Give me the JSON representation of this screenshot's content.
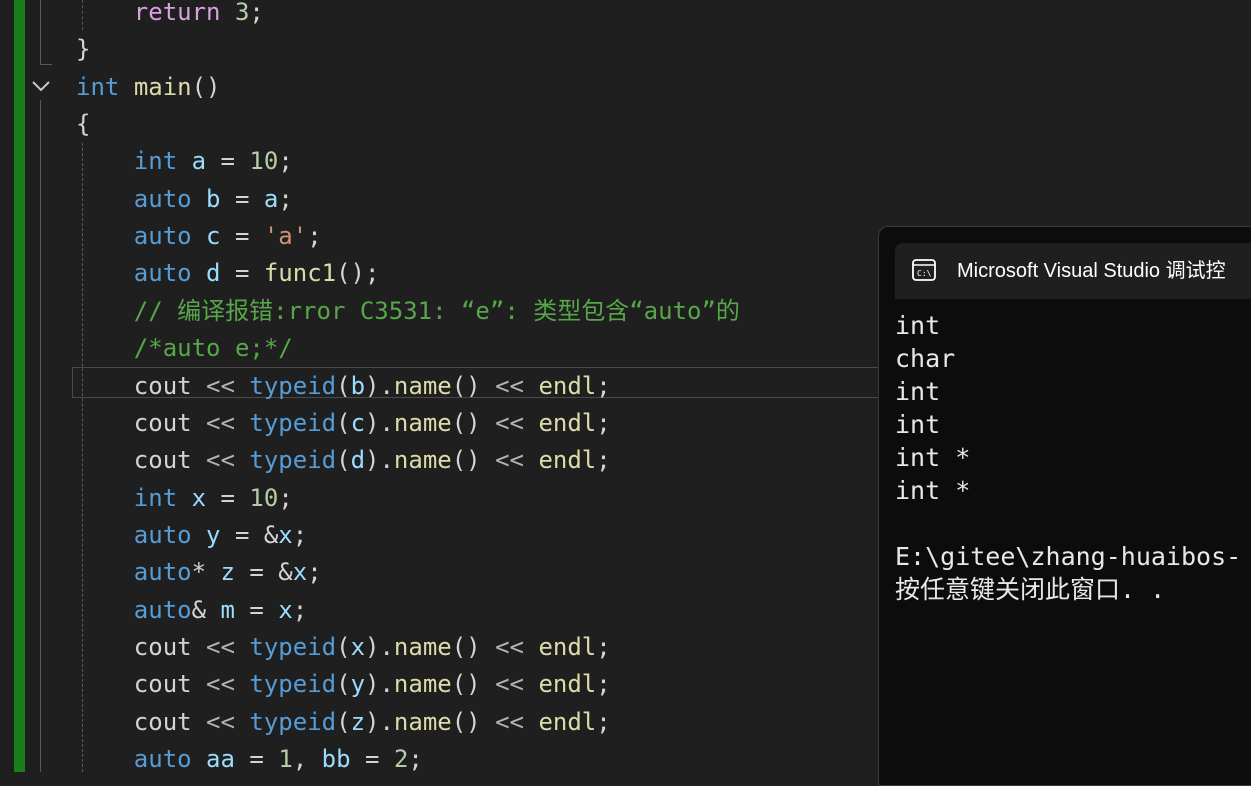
{
  "editor": {
    "lines": [
      {
        "indent": "        ",
        "tokens": [
          [
            "ctl",
            "return"
          ],
          [
            "pl",
            " "
          ],
          [
            "num",
            "3"
          ],
          [
            "pl",
            ";"
          ]
        ]
      },
      {
        "indent": "    ",
        "tokens": [
          [
            "pl",
            "}"
          ]
        ]
      },
      {
        "indent": "    ",
        "tokens": [
          [
            "kw",
            "int"
          ],
          [
            "pl",
            " "
          ],
          [
            "fn",
            "main"
          ],
          [
            "pl",
            "()"
          ]
        ]
      },
      {
        "indent": "    ",
        "tokens": [
          [
            "pl",
            "{"
          ]
        ]
      },
      {
        "indent": "        ",
        "tokens": [
          [
            "kw",
            "int"
          ],
          [
            "pl",
            " "
          ],
          [
            "var",
            "a"
          ],
          [
            "pl",
            " = "
          ],
          [
            "num",
            "10"
          ],
          [
            "pl",
            ";"
          ]
        ]
      },
      {
        "indent": "        ",
        "tokens": [
          [
            "kw",
            "auto"
          ],
          [
            "pl",
            " "
          ],
          [
            "var",
            "b"
          ],
          [
            "pl",
            " = "
          ],
          [
            "var",
            "a"
          ],
          [
            "pl",
            ";"
          ]
        ]
      },
      {
        "indent": "        ",
        "tokens": [
          [
            "kw",
            "auto"
          ],
          [
            "pl",
            " "
          ],
          [
            "var",
            "c"
          ],
          [
            "pl",
            " = "
          ],
          [
            "str",
            "'a'"
          ],
          [
            "pl",
            ";"
          ]
        ]
      },
      {
        "indent": "        ",
        "tokens": [
          [
            "kw",
            "auto"
          ],
          [
            "pl",
            " "
          ],
          [
            "var",
            "d"
          ],
          [
            "pl",
            " = "
          ],
          [
            "fn",
            "func1"
          ],
          [
            "pl",
            "();"
          ]
        ]
      },
      {
        "indent": "        ",
        "tokens": [
          [
            "cmt",
            "// 编译报错:rror C3531: “e”: 类型包含“auto”的"
          ]
        ]
      },
      {
        "indent": "        ",
        "tokens": [
          [
            "cmt",
            "/*auto e;*/"
          ]
        ]
      },
      {
        "indent": "        ",
        "tokens": [
          [
            "pl",
            "cout "
          ],
          [
            "op",
            "<<"
          ],
          [
            "pl",
            " "
          ],
          [
            "kw",
            "typeid"
          ],
          [
            "pl",
            "("
          ],
          [
            "var",
            "b"
          ],
          [
            "pl",
            ")."
          ],
          [
            "fn",
            "name"
          ],
          [
            "pl",
            "() "
          ],
          [
            "op",
            "<<"
          ],
          [
            "pl",
            " "
          ],
          [
            "fn",
            "endl"
          ],
          [
            "pl",
            ";"
          ]
        ]
      },
      {
        "indent": "        ",
        "tokens": [
          [
            "pl",
            "cout "
          ],
          [
            "op",
            "<<"
          ],
          [
            "pl",
            " "
          ],
          [
            "kw",
            "typeid"
          ],
          [
            "pl",
            "("
          ],
          [
            "var",
            "c"
          ],
          [
            "pl",
            ")."
          ],
          [
            "fn",
            "name"
          ],
          [
            "pl",
            "() "
          ],
          [
            "op",
            "<<"
          ],
          [
            "pl",
            " "
          ],
          [
            "fn",
            "endl"
          ],
          [
            "pl",
            ";"
          ]
        ]
      },
      {
        "indent": "        ",
        "tokens": [
          [
            "pl",
            "cout "
          ],
          [
            "op",
            "<<"
          ],
          [
            "pl",
            " "
          ],
          [
            "kw",
            "typeid"
          ],
          [
            "pl",
            "("
          ],
          [
            "var",
            "d"
          ],
          [
            "pl",
            ")."
          ],
          [
            "fn",
            "name"
          ],
          [
            "pl",
            "() "
          ],
          [
            "op",
            "<<"
          ],
          [
            "pl",
            " "
          ],
          [
            "fn",
            "endl"
          ],
          [
            "pl",
            ";"
          ]
        ]
      },
      {
        "indent": "        ",
        "tokens": [
          [
            "kw",
            "int"
          ],
          [
            "pl",
            " "
          ],
          [
            "var",
            "x"
          ],
          [
            "pl",
            " = "
          ],
          [
            "num",
            "10"
          ],
          [
            "pl",
            ";"
          ]
        ]
      },
      {
        "indent": "        ",
        "tokens": [
          [
            "kw",
            "auto"
          ],
          [
            "pl",
            " "
          ],
          [
            "var",
            "y"
          ],
          [
            "pl",
            " = &"
          ],
          [
            "var",
            "x"
          ],
          [
            "pl",
            ";"
          ]
        ]
      },
      {
        "indent": "        ",
        "tokens": [
          [
            "kw",
            "auto"
          ],
          [
            "pl",
            "* "
          ],
          [
            "var",
            "z"
          ],
          [
            "pl",
            " = &"
          ],
          [
            "var",
            "x"
          ],
          [
            "pl",
            ";"
          ]
        ]
      },
      {
        "indent": "        ",
        "tokens": [
          [
            "kw",
            "auto"
          ],
          [
            "pl",
            "& "
          ],
          [
            "var",
            "m"
          ],
          [
            "pl",
            " = "
          ],
          [
            "var",
            "x"
          ],
          [
            "pl",
            ";"
          ]
        ]
      },
      {
        "indent": "        ",
        "tokens": [
          [
            "pl",
            "cout "
          ],
          [
            "op",
            "<<"
          ],
          [
            "pl",
            " "
          ],
          [
            "kw",
            "typeid"
          ],
          [
            "pl",
            "("
          ],
          [
            "var",
            "x"
          ],
          [
            "pl",
            ")."
          ],
          [
            "fn",
            "name"
          ],
          [
            "pl",
            "() "
          ],
          [
            "op",
            "<<"
          ],
          [
            "pl",
            " "
          ],
          [
            "fn",
            "endl"
          ],
          [
            "pl",
            ";"
          ]
        ]
      },
      {
        "indent": "        ",
        "tokens": [
          [
            "pl",
            "cout "
          ],
          [
            "op",
            "<<"
          ],
          [
            "pl",
            " "
          ],
          [
            "kw",
            "typeid"
          ],
          [
            "pl",
            "("
          ],
          [
            "var",
            "y"
          ],
          [
            "pl",
            ")."
          ],
          [
            "fn",
            "name"
          ],
          [
            "pl",
            "() "
          ],
          [
            "op",
            "<<"
          ],
          [
            "pl",
            " "
          ],
          [
            "fn",
            "endl"
          ],
          [
            "pl",
            ";"
          ]
        ]
      },
      {
        "indent": "        ",
        "tokens": [
          [
            "pl",
            "cout "
          ],
          [
            "op",
            "<<"
          ],
          [
            "pl",
            " "
          ],
          [
            "kw",
            "typeid"
          ],
          [
            "pl",
            "("
          ],
          [
            "var",
            "z"
          ],
          [
            "pl",
            ")."
          ],
          [
            "fn",
            "name"
          ],
          [
            "pl",
            "() "
          ],
          [
            "op",
            "<<"
          ],
          [
            "pl",
            " "
          ],
          [
            "fn",
            "endl"
          ],
          [
            "pl",
            ";"
          ]
        ]
      },
      {
        "indent": "        ",
        "tokens": [
          [
            "kw",
            "auto"
          ],
          [
            "pl",
            " "
          ],
          [
            "var",
            "aa"
          ],
          [
            "pl",
            " = "
          ],
          [
            "num",
            "1"
          ],
          [
            "pl",
            ", "
          ],
          [
            "var",
            "bb"
          ],
          [
            "pl",
            " = "
          ],
          [
            "num",
            "2"
          ],
          [
            "pl",
            ";"
          ]
        ]
      }
    ]
  },
  "console": {
    "title": "Microsoft Visual Studio 调试控",
    "icon": "console-icon",
    "output": [
      "int",
      "char",
      "int",
      "int",
      "int *",
      "int *",
      "",
      "E:\\gitee\\zhang-huaibos-",
      "按任意键关闭此窗口. ."
    ]
  },
  "colors": {
    "editor_bg": "#1f1f1f",
    "change_bar": "#1a7f1a",
    "keyword": "#569cd6",
    "comment": "#57a64a",
    "console_bg": "#0c0c0c"
  }
}
